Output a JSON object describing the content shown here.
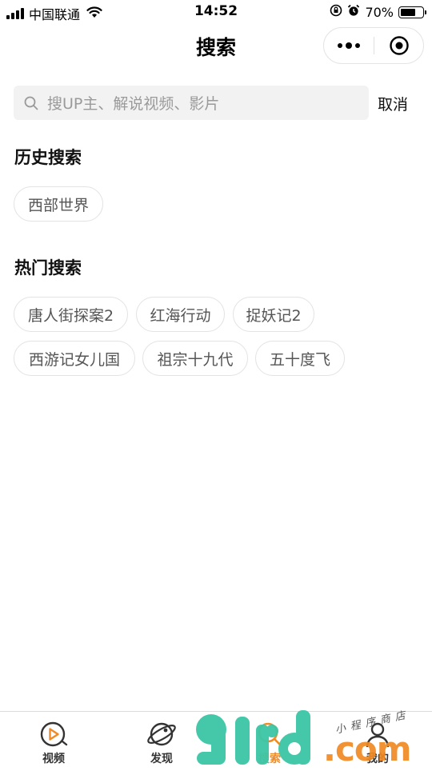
{
  "status_bar": {
    "carrier": "中国联通",
    "time": "14:52",
    "battery": "70%",
    "battery_level": 0.7,
    "icons": [
      "signal-icon",
      "wifi-icon",
      "rotation-lock-icon",
      "alarm-icon",
      "battery-icon"
    ]
  },
  "nav": {
    "title": "搜索",
    "capsule_icons": [
      "more-dots-icon",
      "miniprogram-close-icon"
    ]
  },
  "search": {
    "placeholder": "搜UP主、解说视频、影片",
    "cancel_label": "取消",
    "icon": "search-icon"
  },
  "history": {
    "title": "历史搜索",
    "items": [
      "西部世界"
    ]
  },
  "hot": {
    "title": "热门搜索",
    "items": [
      "唐人街探案2",
      "红海行动",
      "捉妖记2",
      "西游记女儿国",
      "祖宗十九代",
      "五十度飞"
    ]
  },
  "tab_bar": {
    "tabs": [
      {
        "label": "视频",
        "icon": "video-play-icon",
        "active": false
      },
      {
        "label": "发现",
        "icon": "planet-icon",
        "active": false
      },
      {
        "label": "搜索",
        "icon": "search-tab-icon",
        "active": true
      },
      {
        "label": "我的",
        "icon": "user-icon",
        "active": false
      }
    ]
  },
  "watermark": {
    "digits": "91rd",
    "domain": ".com",
    "shop": "小程序商店"
  },
  "colors": {
    "accent": "#f08a24",
    "watermark_green": "#3cc6a6",
    "tag_border": "#e3e3e3",
    "search_bg": "#f2f2f2"
  }
}
